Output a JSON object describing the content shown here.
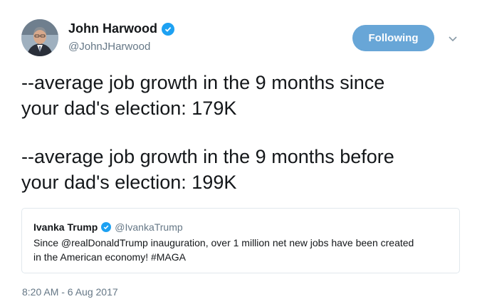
{
  "author": {
    "name": "John Harwood",
    "handle": "@JohnJHarwood"
  },
  "follow_button": {
    "label": "Following"
  },
  "tweet": {
    "lines_para1": [
      "--average job growth in the 9 months since",
      "your dad's election: 179K"
    ],
    "lines_para2": [
      "--average job growth in the 9 months before",
      "your dad's election: 199K"
    ]
  },
  "quoted_tweet": {
    "name": "Ivanka Trump",
    "handle": "@IvankaTrump",
    "text_line1": "Since @realDonaldTrump inauguration, over 1 million net new jobs have been created",
    "text_line2": "in the American economy! #MAGA"
  },
  "timestamp": "8:20 AM - 6 Aug 2017",
  "colors": {
    "verified": "#1da1f2",
    "follow_button": "#68a6d7",
    "secondary_text": "#657786"
  },
  "icons": [
    "verified-badge-icon",
    "chevron-down-icon"
  ]
}
